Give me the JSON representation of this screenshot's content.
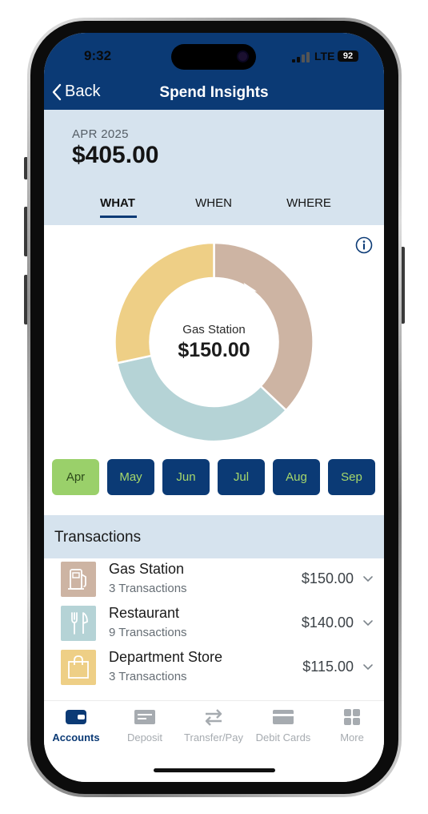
{
  "status_bar": {
    "time": "9:32",
    "network": "LTE",
    "battery": "92"
  },
  "nav": {
    "back_label": "Back",
    "title": "Spend Insights"
  },
  "summary": {
    "period": "APR 2025",
    "total": "$405.00"
  },
  "view_tabs": [
    {
      "label": "WHAT",
      "active": true
    },
    {
      "label": "WHEN",
      "active": false
    },
    {
      "label": "WHERE",
      "active": false
    }
  ],
  "donut": {
    "selected_label": "Gas Station",
    "selected_value": "$150.00",
    "segments": [
      {
        "name": "Gas Station",
        "value": 150,
        "color": "#cdb4a3",
        "selected": true
      },
      {
        "name": "Restaurant",
        "value": 140,
        "color": "#b5d3d6"
      },
      {
        "name": "Department Store",
        "value": 115,
        "color": "#eecf86"
      }
    ]
  },
  "months": [
    {
      "label": "Apr",
      "active": true
    },
    {
      "label": "May",
      "active": false
    },
    {
      "label": "Jun",
      "active": false
    },
    {
      "label": "Jul",
      "active": false
    },
    {
      "label": "Aug",
      "active": false
    },
    {
      "label": "Sep",
      "active": false
    }
  ],
  "transactions": {
    "title": "Transactions",
    "items": [
      {
        "name": "Gas Station",
        "count": "3 Transactions",
        "amount": "$150.00",
        "icon": "gas-pump-icon",
        "color": "#cdb4a3"
      },
      {
        "name": "Restaurant",
        "count": "9 Transactions",
        "amount": "$140.00",
        "icon": "fork-knife-icon",
        "color": "#b5d3d6"
      },
      {
        "name": "Department Store",
        "count": "3 Transactions",
        "amount": "$115.00",
        "icon": "shopping-bag-icon",
        "color": "#eecf86"
      }
    ]
  },
  "tabbar": [
    {
      "label": "Accounts",
      "icon": "wallet-icon",
      "active": true
    },
    {
      "label": "Deposit",
      "icon": "check-deposit-icon",
      "active": false
    },
    {
      "label": "Transfer/Pay",
      "icon": "transfer-icon",
      "active": false
    },
    {
      "label": "Debit Cards",
      "icon": "card-icon",
      "active": false
    },
    {
      "label": "More",
      "icon": "grid-icon",
      "active": false
    }
  ],
  "colors": {
    "brand": "#0b3a75",
    "panel": "#d6e3ee",
    "month_active": "#9ad06a",
    "month_text": "#a6d86b"
  }
}
